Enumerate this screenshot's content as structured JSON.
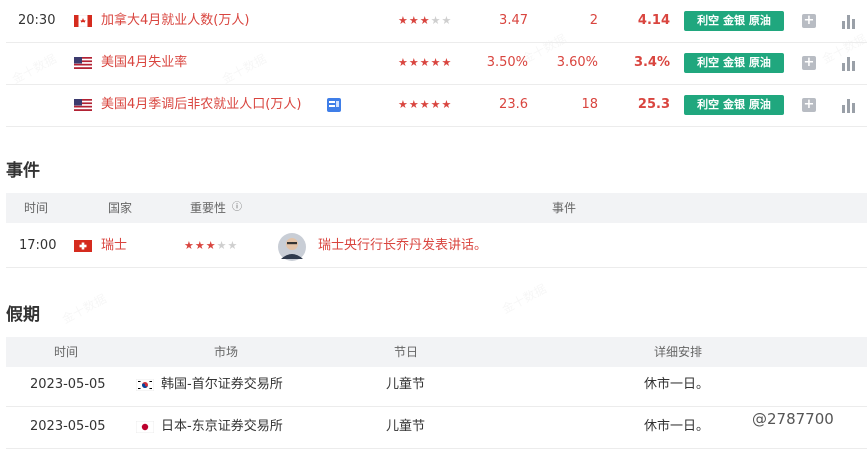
{
  "indicators": [
    {
      "time": "20:30",
      "country_flag": "canada",
      "name": "加拿大4月就业人数(万人)",
      "stars": 3,
      "previous": "3.47",
      "forecast": "2",
      "actual": "4.14",
      "tag": "利空 金银 原油",
      "has_doc_icon": false
    },
    {
      "time": "",
      "country_flag": "usa",
      "name": "美国4月失业率",
      "stars": 5,
      "previous": "3.50%",
      "forecast": "3.60%",
      "actual": "3.4%",
      "tag": "利空 金银 原油",
      "has_doc_icon": false
    },
    {
      "time": "",
      "country_flag": "usa",
      "name": "美国4月季调后非农就业人口(万人)",
      "stars": 5,
      "previous": "23.6",
      "forecast": "18",
      "actual": "25.3",
      "tag": "利空 金银 原油",
      "has_doc_icon": true
    }
  ],
  "events": {
    "title": "事件",
    "headers": {
      "time": "时间",
      "country": "国家",
      "importance": "重要性",
      "event": "事件"
    },
    "rows": [
      {
        "time": "17:00",
        "country_flag": "switzerland",
        "country": "瑞士",
        "stars": 3,
        "event": "瑞士央行行长乔丹发表讲话。"
      }
    ]
  },
  "holidays": {
    "title": "假期",
    "headers": {
      "time": "时间",
      "market": "市场",
      "holiday": "节日",
      "detail": "详细安排"
    },
    "rows": [
      {
        "date": "2023-05-05",
        "country_flag": "korea",
        "market": "韩国-首尔证券交易所",
        "holiday": "儿童节",
        "detail": "休市一日。"
      },
      {
        "date": "2023-05-05",
        "country_flag": "japan",
        "market": "日本-东京证券交易所",
        "holiday": "儿童节",
        "detail": "休市一日。"
      }
    ]
  },
  "watermark_text": "金十数据",
  "user_mark": "@2787700",
  "colors": {
    "accent_red": "#d9453f",
    "tag_green": "#20a77e",
    "header_bg": "#f2f3f5"
  }
}
